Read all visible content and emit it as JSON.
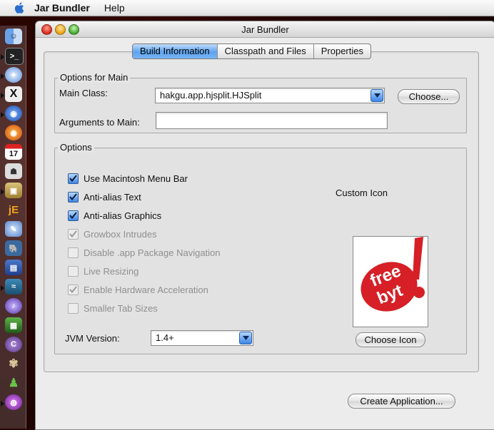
{
  "menubar": {
    "app_name": "Jar Bundler",
    "menu_help": "Help"
  },
  "window": {
    "title": "Jar Bundler"
  },
  "tabs": [
    {
      "label": "Build Information",
      "selected": true
    },
    {
      "label": "Classpath and Files",
      "selected": false
    },
    {
      "label": "Properties",
      "selected": false
    }
  ],
  "options_main": {
    "title": "Options for Main",
    "main_class_label": "Main Class:",
    "main_class_value": "hakgu.app.hjsplit.HJSplit",
    "choose_button": "Choose...",
    "arguments_label": "Arguments to Main:",
    "arguments_value": ""
  },
  "options": {
    "title": "Options",
    "checkboxes": [
      {
        "label": "Use Macintosh Menu Bar",
        "checked": true,
        "enabled": true
      },
      {
        "label": "Anti-alias Text",
        "checked": true,
        "enabled": true
      },
      {
        "label": "Anti-alias Graphics",
        "checked": true,
        "enabled": true
      },
      {
        "label": "Growbox Intrudes",
        "checked": true,
        "enabled": false
      },
      {
        "label": "Disable .app Package Navigation",
        "checked": false,
        "enabled": false
      },
      {
        "label": "Live Resizing",
        "checked": false,
        "enabled": false
      },
      {
        "label": "Enable Hardware Acceleration",
        "checked": true,
        "enabled": false
      },
      {
        "label": "Smaller Tab Sizes",
        "checked": false,
        "enabled": false
      }
    ],
    "custom_icon_label": "Custom Icon",
    "icon_text_line1": "free",
    "icon_text_line2": "byt",
    "choose_icon_button": "Choose Icon",
    "jvm_label": "JVM Version:",
    "jvm_value": "1.4+"
  },
  "create_button": "Create Application...",
  "dock_icons": [
    "finder-icon",
    "terminal-icon",
    "safari-icon",
    "x11-icon",
    "firefox-alt-icon",
    "firefox-icon",
    "ical-icon",
    "address-book-icon",
    "package-icon",
    "jedit-icon",
    "editor-icon",
    "postgresql-icon",
    "calculator-icon",
    "network-icon",
    "itunes-icon",
    "console-icon",
    "colorsync-icon",
    "gimp-icon",
    "android-icon",
    "globe-icon"
  ],
  "dock_ical_day": "17",
  "dock_jedit_letters": "jE",
  "dock_colorsync_letter": "C",
  "colors": {
    "accent": "#3d86e6",
    "icon_red": "#d61f26"
  }
}
